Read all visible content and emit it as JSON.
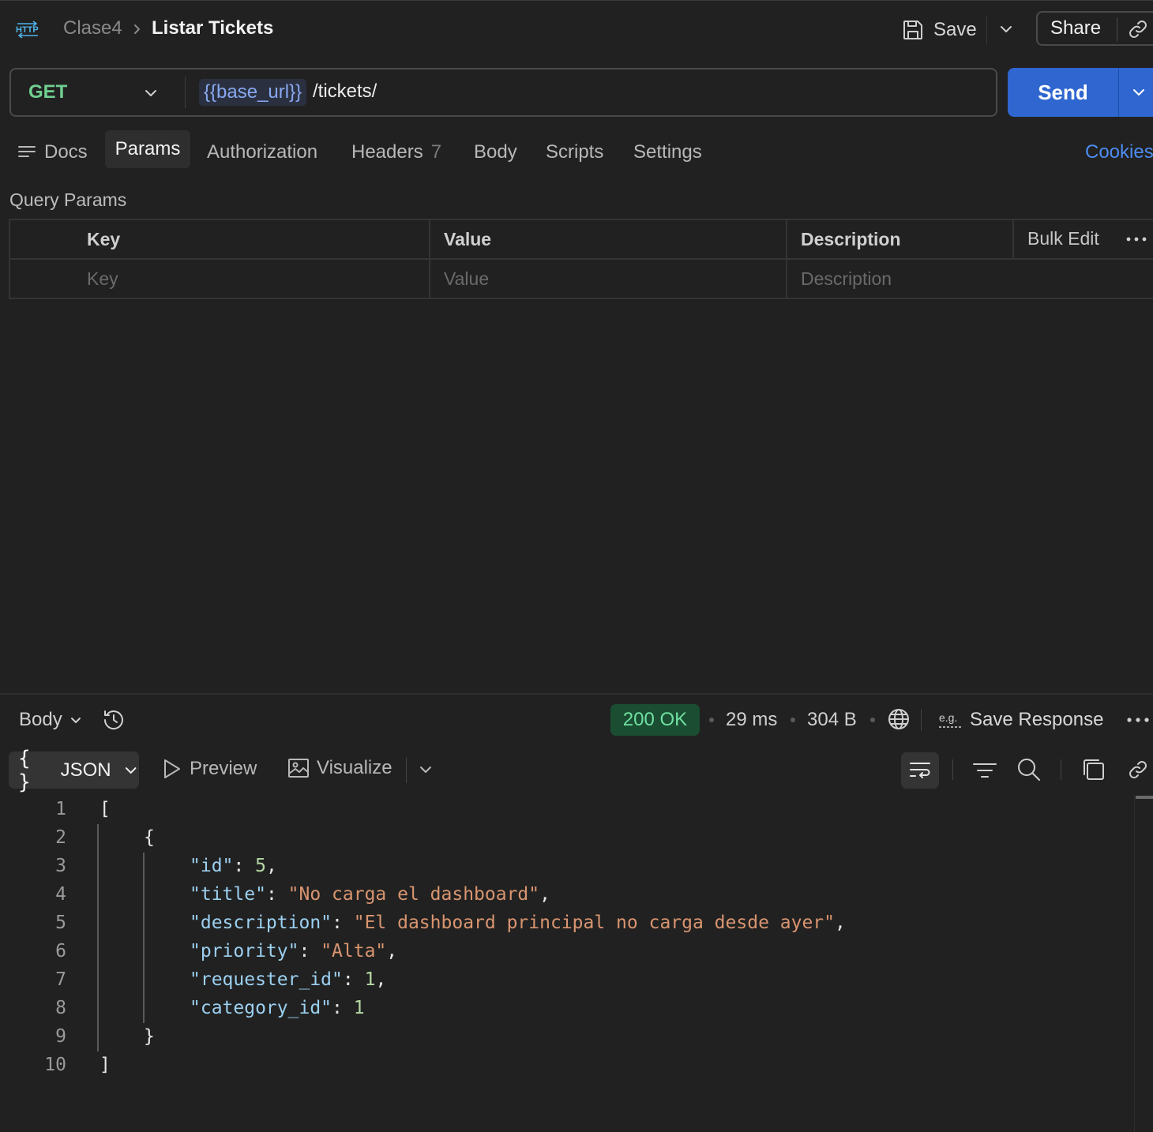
{
  "header": {
    "icon_label": "HTTP",
    "breadcrumb_parent": "Clase4",
    "title": "Listar Tickets",
    "save_label": "Save",
    "share_label": "Share"
  },
  "request": {
    "method": "GET",
    "url_variable": "{{base_url}}",
    "url_path": "/tickets/",
    "send_label": "Send"
  },
  "tabs": {
    "docs": "Docs",
    "params": "Params",
    "authorization": "Authorization",
    "headers": "Headers",
    "headers_count": "7",
    "body": "Body",
    "scripts": "Scripts",
    "settings": "Settings",
    "cookies": "Cookies"
  },
  "query_params": {
    "title": "Query Params",
    "columns": {
      "key": "Key",
      "value": "Value",
      "description": "Description"
    },
    "bulk_edit": "Bulk Edit",
    "placeholders": {
      "key": "Key",
      "value": "Value",
      "description": "Description"
    }
  },
  "response": {
    "tab_label": "Body",
    "status": "200 OK",
    "time": "29 ms",
    "size": "304 B",
    "save_response": "Save Response",
    "eg_label": "e.g.",
    "format_braces": "{ }",
    "format": "JSON",
    "preview": "Preview",
    "visualize": "Visualize"
  },
  "code": {
    "line_numbers": [
      "1",
      "2",
      "3",
      "4",
      "5",
      "6",
      "7",
      "8",
      "9",
      "10"
    ],
    "lines": [
      {
        "parts": [
          {
            "t": "[",
            "c": "p"
          }
        ]
      },
      {
        "parts": [
          {
            "t": "{",
            "c": "p"
          }
        ]
      },
      {
        "parts": [
          {
            "t": "\"id\"",
            "c": "k"
          },
          {
            "t": ": ",
            "c": "p"
          },
          {
            "t": "5",
            "c": "n"
          },
          {
            "t": ",",
            "c": "p"
          }
        ]
      },
      {
        "parts": [
          {
            "t": "\"title\"",
            "c": "k"
          },
          {
            "t": ": ",
            "c": "p"
          },
          {
            "t": "\"No carga el dashboard\"",
            "c": "s"
          },
          {
            "t": ",",
            "c": "p"
          }
        ]
      },
      {
        "parts": [
          {
            "t": "\"description\"",
            "c": "k"
          },
          {
            "t": ": ",
            "c": "p"
          },
          {
            "t": "\"El dashboard principal no carga desde ayer\"",
            "c": "s"
          },
          {
            "t": ",",
            "c": "p"
          }
        ]
      },
      {
        "parts": [
          {
            "t": "\"priority\"",
            "c": "k"
          },
          {
            "t": ": ",
            "c": "p"
          },
          {
            "t": "\"Alta\"",
            "c": "s"
          },
          {
            "t": ",",
            "c": "p"
          }
        ]
      },
      {
        "parts": [
          {
            "t": "\"requester_id\"",
            "c": "k"
          },
          {
            "t": ": ",
            "c": "p"
          },
          {
            "t": "1",
            "c": "n"
          },
          {
            "t": ",",
            "c": "p"
          }
        ]
      },
      {
        "parts": [
          {
            "t": "\"category_id\"",
            "c": "k"
          },
          {
            "t": ": ",
            "c": "p"
          },
          {
            "t": "1",
            "c": "n"
          }
        ]
      },
      {
        "parts": [
          {
            "t": "}",
            "c": "p"
          }
        ]
      },
      {
        "parts": [
          {
            "t": "]",
            "c": "p"
          }
        ]
      }
    ]
  },
  "colors": {
    "background": "#212121",
    "accent_blue": "#2f66d0",
    "method_green": "#6fcf8f",
    "status_green": "#6fe0a0",
    "json_key": "#9cd0f0",
    "json_string": "#d99570",
    "json_number": "#b5d9a5"
  },
  "icons": [
    "http-icon",
    "save-icon",
    "chevron-down-icon",
    "link-icon",
    "docs-lines-icon",
    "history-icon",
    "globe-icon",
    "more-icon",
    "play-icon",
    "image-icon",
    "wrap-icon",
    "filter-icon",
    "search-icon",
    "copy-icon"
  ]
}
